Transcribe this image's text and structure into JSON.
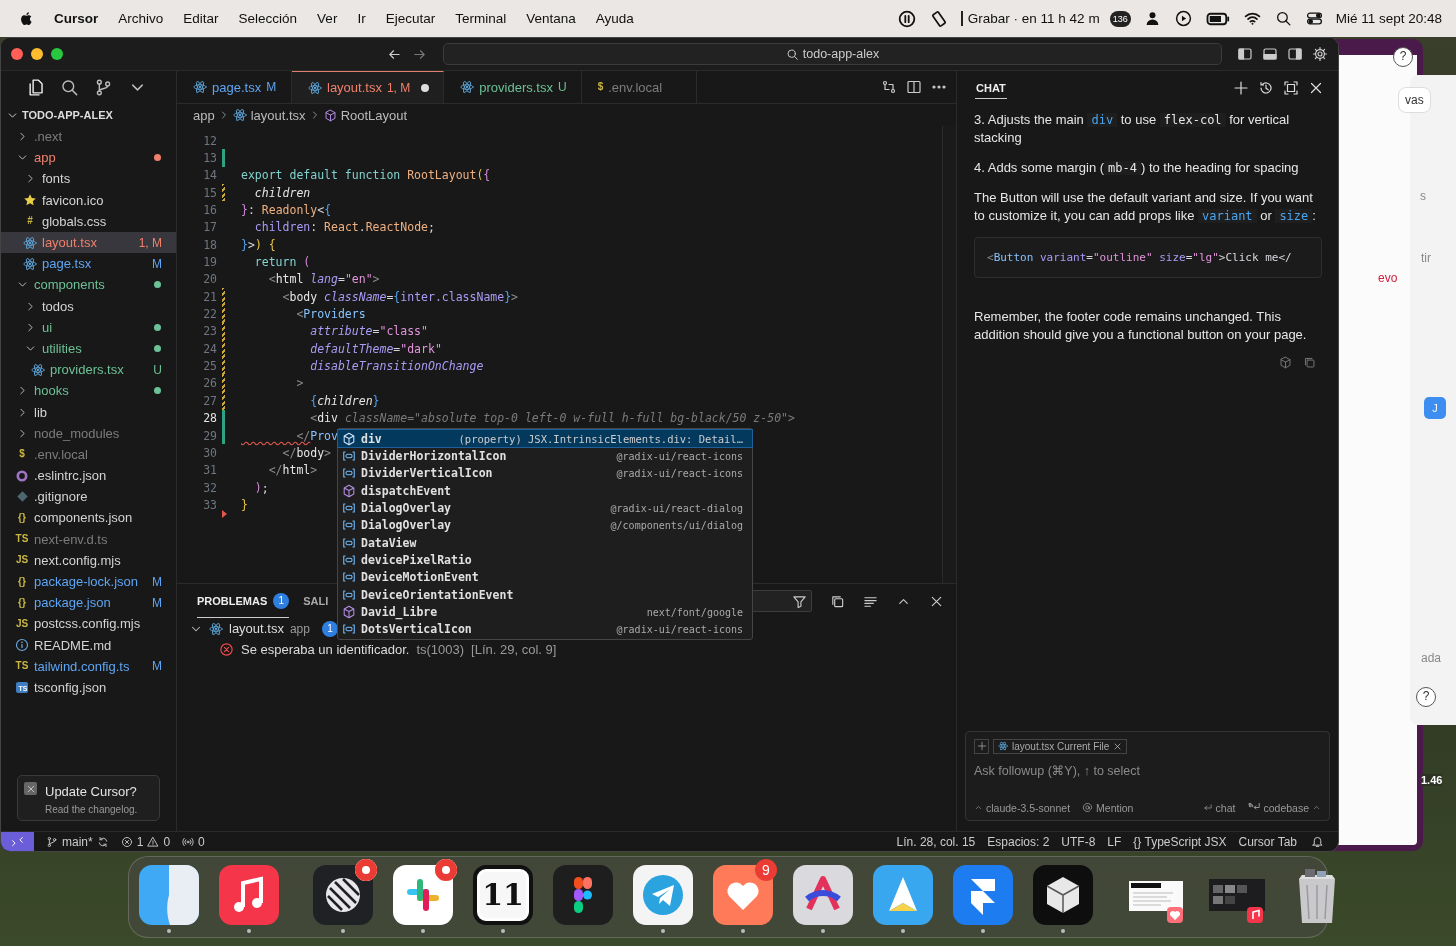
{
  "menubar": {
    "app": "Cursor",
    "menus": [
      "Archivo",
      "Editar",
      "Selección",
      "Ver",
      "Ir",
      "Ejecutar",
      "Terminal",
      "Ventana",
      "Ayuda"
    ],
    "recording": "Grabar · en 11 h 42 m",
    "notifications": "136",
    "clock": "Mié 11 sept 20:48"
  },
  "window": {
    "search": "todo-app-alex"
  },
  "explorer": {
    "title": "TODO-APP-ALEX",
    "tree": [
      {
        "name": ".next",
        "kind": "folder",
        "color": "#7c7c7c",
        "expanded": false,
        "selected": false
      },
      {
        "name": "app",
        "kind": "folder",
        "color": "#f0806c",
        "expanded": true,
        "dot": true,
        "selected": false,
        "children": [
          {
            "name": "fonts",
            "kind": "folder",
            "color": "#d4d4d4",
            "expanded": false,
            "selected": false
          },
          {
            "name": "favicon.ico",
            "kind": "star",
            "color": "#d4d4d4",
            "selected": false
          },
          {
            "name": "globals.css",
            "kind": "text",
            "icon_text": "#",
            "color": "#d4d4d4",
            "selected": false
          },
          {
            "name": "layout.tsx",
            "kind": "react",
            "color": "#f0806c",
            "badge": "1, M",
            "selected": true
          },
          {
            "name": "page.tsx",
            "kind": "react",
            "color": "#5ea5f3",
            "badge": "M",
            "selected": false
          }
        ]
      },
      {
        "name": "components",
        "kind": "folder",
        "color": "#6cc196",
        "expanded": true,
        "dot": true,
        "selected": false,
        "children": [
          {
            "name": "todos",
            "kind": "folder",
            "color": "#d4d4d4",
            "expanded": false,
            "selected": false
          },
          {
            "name": "ui",
            "kind": "folder",
            "color": "#6cc196",
            "expanded": false,
            "dot": true,
            "selected": false
          },
          {
            "name": "utilities",
            "kind": "folder",
            "color": "#6cc196",
            "expanded": true,
            "dot": true,
            "selected": false,
            "children": [
              {
                "name": "providers.tsx",
                "kind": "react",
                "color": "#6cc196",
                "badge": "U",
                "selected": false
              }
            ]
          }
        ]
      },
      {
        "name": "hooks",
        "kind": "folder",
        "color": "#6cc196",
        "expanded": false,
        "dot": true,
        "selected": false
      },
      {
        "name": "lib",
        "kind": "folder",
        "color": "#d4d4d4",
        "expanded": false,
        "selected": false
      },
      {
        "name": "node_modules",
        "kind": "folder",
        "color": "#7c7c7c",
        "expanded": false,
        "selected": false
      },
      {
        "name": ".env.local",
        "kind": "text",
        "icon_text": "$",
        "color": "#7c7c7c",
        "selected": false
      },
      {
        "name": ".eslintrc.json",
        "kind": "ring",
        "color": "#d4d4d4",
        "selected": false
      },
      {
        "name": ".gitignore",
        "kind": "diamond",
        "color": "#d4d4d4",
        "selected": false
      },
      {
        "name": "components.json",
        "kind": "text",
        "icon_text": "{}",
        "color": "#d4d4d4",
        "selected": false
      },
      {
        "name": "next-env.d.ts",
        "kind": "text",
        "icon_text": "TS",
        "color": "#7c7c7c",
        "selected": false
      },
      {
        "name": "next.config.mjs",
        "kind": "text",
        "icon_text": "JS",
        "color": "#d4d4d4",
        "selected": false
      },
      {
        "name": "package-lock.json",
        "kind": "text",
        "icon_text": "{}",
        "color": "#5ea5f3",
        "badge": "M",
        "selected": false
      },
      {
        "name": "package.json",
        "kind": "text",
        "icon_text": "{}",
        "color": "#5ea5f3",
        "badge": "M",
        "selected": false
      },
      {
        "name": "postcss.config.mjs",
        "kind": "text",
        "icon_text": "JS",
        "color": "#d4d4d4",
        "selected": false
      },
      {
        "name": "README.md",
        "kind": "info",
        "color": "#d4d4d4",
        "selected": false
      },
      {
        "name": "tailwind.config.ts",
        "kind": "text",
        "icon_text": "TS",
        "color": "#5ea5f3",
        "badge": "M",
        "selected": false
      },
      {
        "name": "tsconfig.json",
        "kind": "tsbox",
        "icon_text": "TS",
        "color": "#d4d4d4",
        "selected": false
      }
    ]
  },
  "notification": {
    "title": "Update Cursor?",
    "subtitle": "Read the changelog."
  },
  "tabs": [
    {
      "label": "page.tsx",
      "kind": "react",
      "color": "#5ea5f3",
      "badge": "M",
      "selected": false,
      "dirty": false
    },
    {
      "label": "layout.tsx",
      "kind": "react",
      "color": "#f0806c",
      "badge": "1, M",
      "selected": true,
      "dirty": true
    },
    {
      "label": "providers.tsx",
      "kind": "react",
      "color": "#6cc196",
      "badge": "U",
      "selected": false,
      "dirty": false
    },
    {
      "label": ".env.local",
      "kind": "text",
      "icon_text": "$",
      "color": "#7c7c7c",
      "selected": false,
      "dirty": false
    }
  ],
  "breadcrumb": [
    {
      "label": "app",
      "kind": "folder"
    },
    {
      "label": "layout.tsx",
      "kind": "react"
    },
    {
      "label": "RootLayout",
      "kind": "cube"
    }
  ],
  "code": [
    {
      "number": "12",
      "current": false
    },
    {
      "number": "13",
      "kind": "added",
      "current": false
    },
    {
      "number": "14",
      "current": false,
      "tokens": [
        {
          "t": "export default function ",
          "kind": "k"
        },
        {
          "t": "RootLayout",
          "kind": "fn"
        },
        {
          "t": "(",
          "kind": "by"
        },
        {
          "t": "{",
          "kind": "bp"
        }
      ]
    },
    {
      "number": "15",
      "kind": "modified",
      "current": false,
      "tokens": [
        {
          "t": "  children",
          "kind": "v"
        }
      ]
    },
    {
      "number": "16",
      "current": false,
      "tokens": [
        {
          "t": "}",
          "kind": "bp"
        },
        {
          "t": ": ",
          "kind": "p"
        },
        {
          "t": "Readonly",
          "kind": "ty"
        },
        {
          "t": "<",
          "kind": "p"
        },
        {
          "t": "{",
          "kind": "bb"
        }
      ]
    },
    {
      "number": "17",
      "current": false,
      "tokens": [
        {
          "t": "  children",
          "kind": "pr"
        },
        {
          "t": ": ",
          "kind": "p"
        },
        {
          "t": "React",
          "kind": "ty"
        },
        {
          "t": ".",
          "kind": "p"
        },
        {
          "t": "ReactNode",
          "kind": "ty"
        },
        {
          "t": ";",
          "kind": "p"
        }
      ]
    },
    {
      "number": "18",
      "current": false,
      "tokens": [
        {
          "t": "}",
          "kind": "bb"
        },
        {
          "t": ">",
          "kind": "p"
        },
        {
          "t": ")",
          "kind": "by"
        },
        {
          "t": " {",
          "kind": "by"
        }
      ]
    },
    {
      "number": "19",
      "current": false,
      "tokens": [
        {
          "t": "  return ",
          "kind": "k"
        },
        {
          "t": "(",
          "kind": "bp"
        }
      ]
    },
    {
      "number": "20",
      "current": false,
      "tokens": [
        {
          "t": "    <",
          "kind": "tg"
        },
        {
          "t": "html",
          "kind": "tn"
        },
        {
          "t": " lang",
          "kind": "at"
        },
        {
          "t": "=",
          "kind": "p"
        },
        {
          "t": "\"en\"",
          "kind": "st"
        },
        {
          "t": ">",
          "kind": "tg"
        }
      ]
    },
    {
      "number": "21",
      "kind": "modified",
      "current": false,
      "tokens": [
        {
          "t": "      <",
          "kind": "tg"
        },
        {
          "t": "body",
          "kind": "tn"
        },
        {
          "t": " className",
          "kind": "at"
        },
        {
          "t": "=",
          "kind": "p"
        },
        {
          "t": "{",
          "kind": "bb"
        },
        {
          "t": "inter.className",
          "kind": "pr"
        },
        {
          "t": "}",
          "kind": "bb"
        },
        {
          "t": ">",
          "kind": "tg"
        }
      ]
    },
    {
      "number": "22",
      "kind": "modified",
      "current": false,
      "tokens": [
        {
          "t": "        <",
          "kind": "tg"
        },
        {
          "t": "Providers",
          "kind": "tc"
        }
      ]
    },
    {
      "number": "23",
      "kind": "modified",
      "current": false,
      "tokens": [
        {
          "t": "          attribute",
          "kind": "at"
        },
        {
          "t": "=",
          "kind": "p"
        },
        {
          "t": "\"class\"",
          "kind": "st"
        }
      ]
    },
    {
      "number": "24",
      "kind": "modified",
      "current": false,
      "tokens": [
        {
          "t": "          defaultTheme",
          "kind": "at"
        },
        {
          "t": "=",
          "kind": "p"
        },
        {
          "t": "\"dark\"",
          "kind": "st"
        }
      ]
    },
    {
      "number": "25",
      "kind": "modified",
      "current": false,
      "tokens": [
        {
          "t": "          disableTransitionOnChange",
          "kind": "at"
        }
      ]
    },
    {
      "number": "26",
      "kind": "modified",
      "current": false,
      "tokens": [
        {
          "t": "        >",
          "kind": "tg"
        }
      ]
    },
    {
      "number": "27",
      "kind": "modified",
      "current": false,
      "tokens": [
        {
          "t": "          {",
          "kind": "bb"
        },
        {
          "t": "children",
          "kind": "v"
        },
        {
          "t": "}",
          "kind": "bb"
        }
      ]
    },
    {
      "number": "28",
      "kind": "added",
      "current": true,
      "tokens": [
        {
          "t": "          <",
          "kind": "tg"
        },
        {
          "t": "div",
          "kind": "tn"
        },
        {
          "t": " className=\"absolute top-0 left-0 w-full h-full bg-black/50 z-50\">",
          "kind": "gh"
        }
      ]
    },
    {
      "number": "29",
      "kind": "added",
      "current": false,
      "tokens": [
        {
          "t": "        </",
          "kind": "er"
        },
        {
          "t": "Prov",
          "kind": "tc"
        }
      ]
    },
    {
      "number": "30",
      "current": false,
      "tokens": [
        {
          "t": "      </",
          "kind": "tg"
        },
        {
          "t": "body",
          "kind": "tn"
        },
        {
          "t": ">",
          "kind": "tg"
        }
      ]
    },
    {
      "number": "31",
      "current": false,
      "tokens": [
        {
          "t": "    </",
          "kind": "tg"
        },
        {
          "t": "html",
          "kind": "tn"
        },
        {
          "t": ">",
          "kind": "tg"
        }
      ]
    },
    {
      "number": "32",
      "current": false,
      "tokens": [
        {
          "t": "  )",
          "kind": "bp"
        },
        {
          "t": ";",
          "kind": "p"
        }
      ]
    },
    {
      "number": "33",
      "kind": "deleted",
      "current": false,
      "tokens": [
        {
          "t": "}",
          "kind": "by"
        }
      ]
    }
  ],
  "suggestions": [
    {
      "label": "div",
      "kind": "property",
      "detail": "(property) JSX.IntrinsicElements.div: Detail…",
      "selected": true
    },
    {
      "label": "DividerHorizontalIcon",
      "kind": "variable",
      "detail": "@radix-ui/react-icons",
      "selected": false
    },
    {
      "label": "DividerVerticalIcon",
      "kind": "variable",
      "detail": "@radix-ui/react-icons",
      "selected": false
    },
    {
      "label": "dispatchEvent",
      "kind": "method",
      "selected": false
    },
    {
      "label": "DialogOverlay",
      "kind": "variable",
      "detail": "@radix-ui/react-dialog",
      "selected": false
    },
    {
      "label": "DialogOverlay",
      "kind": "variable",
      "detail": "@/components/ui/dialog",
      "selected": false
    },
    {
      "label": "DataView",
      "kind": "variable",
      "selected": false
    },
    {
      "label": "devicePixelRatio",
      "kind": "variable",
      "selected": false
    },
    {
      "label": "DeviceMotionEvent",
      "kind": "variable",
      "selected": false
    },
    {
      "label": "DeviceOrientationEvent",
      "kind": "variable",
      "selected": false
    },
    {
      "label": "David_Libre",
      "kind": "method",
      "detail": "next/font/google",
      "selected": false
    },
    {
      "label": "DotsVerticalIcon",
      "kind": "variable",
      "detail": "@radix-ui/react-icons",
      "selected": false
    }
  ],
  "panel": {
    "tabs": [
      {
        "label": "PROBLEMAS",
        "count": "1",
        "selected": true
      },
      {
        "label": "SALI",
        "selected": false
      }
    ],
    "file": {
      "name": "layout.tsx",
      "folder": "app",
      "count": "1",
      "expanded": true
    },
    "problems": [
      {
        "message": "Se esperaba un identificador.",
        "code": "ts(1003)",
        "location": "[Lín. 29, col. 9]"
      }
    ]
  },
  "chat": {
    "tab": "CHAT",
    "paragraphs": [
      {
        "kind": "text",
        "parts": [
          {
            "t": "3. Adjusts the main "
          },
          {
            "code": "div",
            "kind": "ref"
          },
          {
            "t": " to use "
          },
          {
            "code": "flex-col",
            "kind": "plain"
          },
          {
            "t": " for vertical stacking"
          }
        ]
      },
      {
        "kind": "text",
        "parts": [
          {
            "t": "4. Adds some margin ("
          },
          {
            "code": "mb-4",
            "kind": "plain"
          },
          {
            "t": ") to the heading for spacing"
          }
        ]
      },
      {
        "kind": "text",
        "parts": [
          {
            "t": "The Button will use the default variant and size. If you want to customize it, you can add props like "
          },
          {
            "code": "variant",
            "kind": "ref"
          },
          {
            "t": " or "
          },
          {
            "code": "size",
            "kind": "ref"
          },
          {
            "t": ":"
          }
        ]
      },
      {
        "kind": "code",
        "tokens": [
          {
            "t": "<",
            "kind": "tg"
          },
          {
            "t": "Button",
            "kind": "tc"
          },
          {
            "t": " variant",
            "kind": "pr"
          },
          {
            "t": "=",
            "kind": "p"
          },
          {
            "t": "\"outline\"",
            "kind": "st"
          },
          {
            "t": " size",
            "kind": "pr"
          },
          {
            "t": "=",
            "kind": "p"
          },
          {
            "t": "\"lg\"",
            "kind": "st"
          },
          {
            "t": ">Click me</",
            "kind": "p"
          }
        ]
      },
      {
        "kind": "text",
        "parts": [
          {
            "t": "Remember, the footer code remains unchanged. This addition should give you a functional button on your page."
          }
        ]
      }
    ],
    "context_chip": {
      "file": "layout.tsx",
      "note": "Current File"
    },
    "placeholder": "Ask followup (⌘Y), ↑ to select",
    "model": "claude-3.5-sonnet",
    "mention": "Mention",
    "send": "chat",
    "send_codebase": "codebase"
  },
  "status_bar": {
    "branch": "main*",
    "errors": "1",
    "warnings": "0",
    "ports": "0",
    "items": [
      "Lín. 28, col. 15",
      "Espacios: 2",
      "UTF-8",
      "LF",
      "{} TypeScript JSX",
      "Cursor Tab"
    ]
  },
  "background_window": {
    "texts": [
      {
        "text": "vas",
        "kind": "button"
      },
      {
        "text": "s",
        "kind": "label"
      },
      {
        "text": "tir",
        "kind": "label"
      },
      {
        "text": "evo",
        "kind": "accent"
      },
      {
        "text": "J",
        "kind": "avatar"
      },
      {
        "text": "ada",
        "kind": "label"
      },
      {
        "text": "?",
        "kind": "help"
      },
      {
        "text": "1.46",
        "kind": "value"
      },
      {
        "text": "?",
        "kind": "help-top"
      }
    ]
  },
  "dock": [
    {
      "kind": "finder",
      "running": true,
      "alert": false
    },
    {
      "kind": "music",
      "running": true,
      "alert": false
    },
    {
      "kind": "separator"
    },
    {
      "kind": "linear",
      "running": true,
      "alert": true
    },
    {
      "kind": "slack",
      "running": true,
      "alert": true
    },
    {
      "kind": "calendar",
      "label": "11",
      "running": true,
      "alert": false
    },
    {
      "kind": "figma",
      "running": false,
      "alert": false
    },
    {
      "kind": "telegram",
      "running": true,
      "alert": false
    },
    {
      "kind": "heart",
      "running": true,
      "alert": false,
      "badge": "9"
    },
    {
      "kind": "arc",
      "running": true,
      "alert": false
    },
    {
      "kind": "spark",
      "running": true,
      "alert": false
    },
    {
      "kind": "framer",
      "running": true,
      "alert": false
    },
    {
      "kind": "cube",
      "running": true,
      "alert": false
    },
    {
      "kind": "separator"
    },
    {
      "kind": "window-doc",
      "running": false,
      "alert": false
    },
    {
      "kind": "window-dark",
      "running": false,
      "alert": false
    },
    {
      "kind": "trash",
      "running": false,
      "alert": false
    }
  ]
}
